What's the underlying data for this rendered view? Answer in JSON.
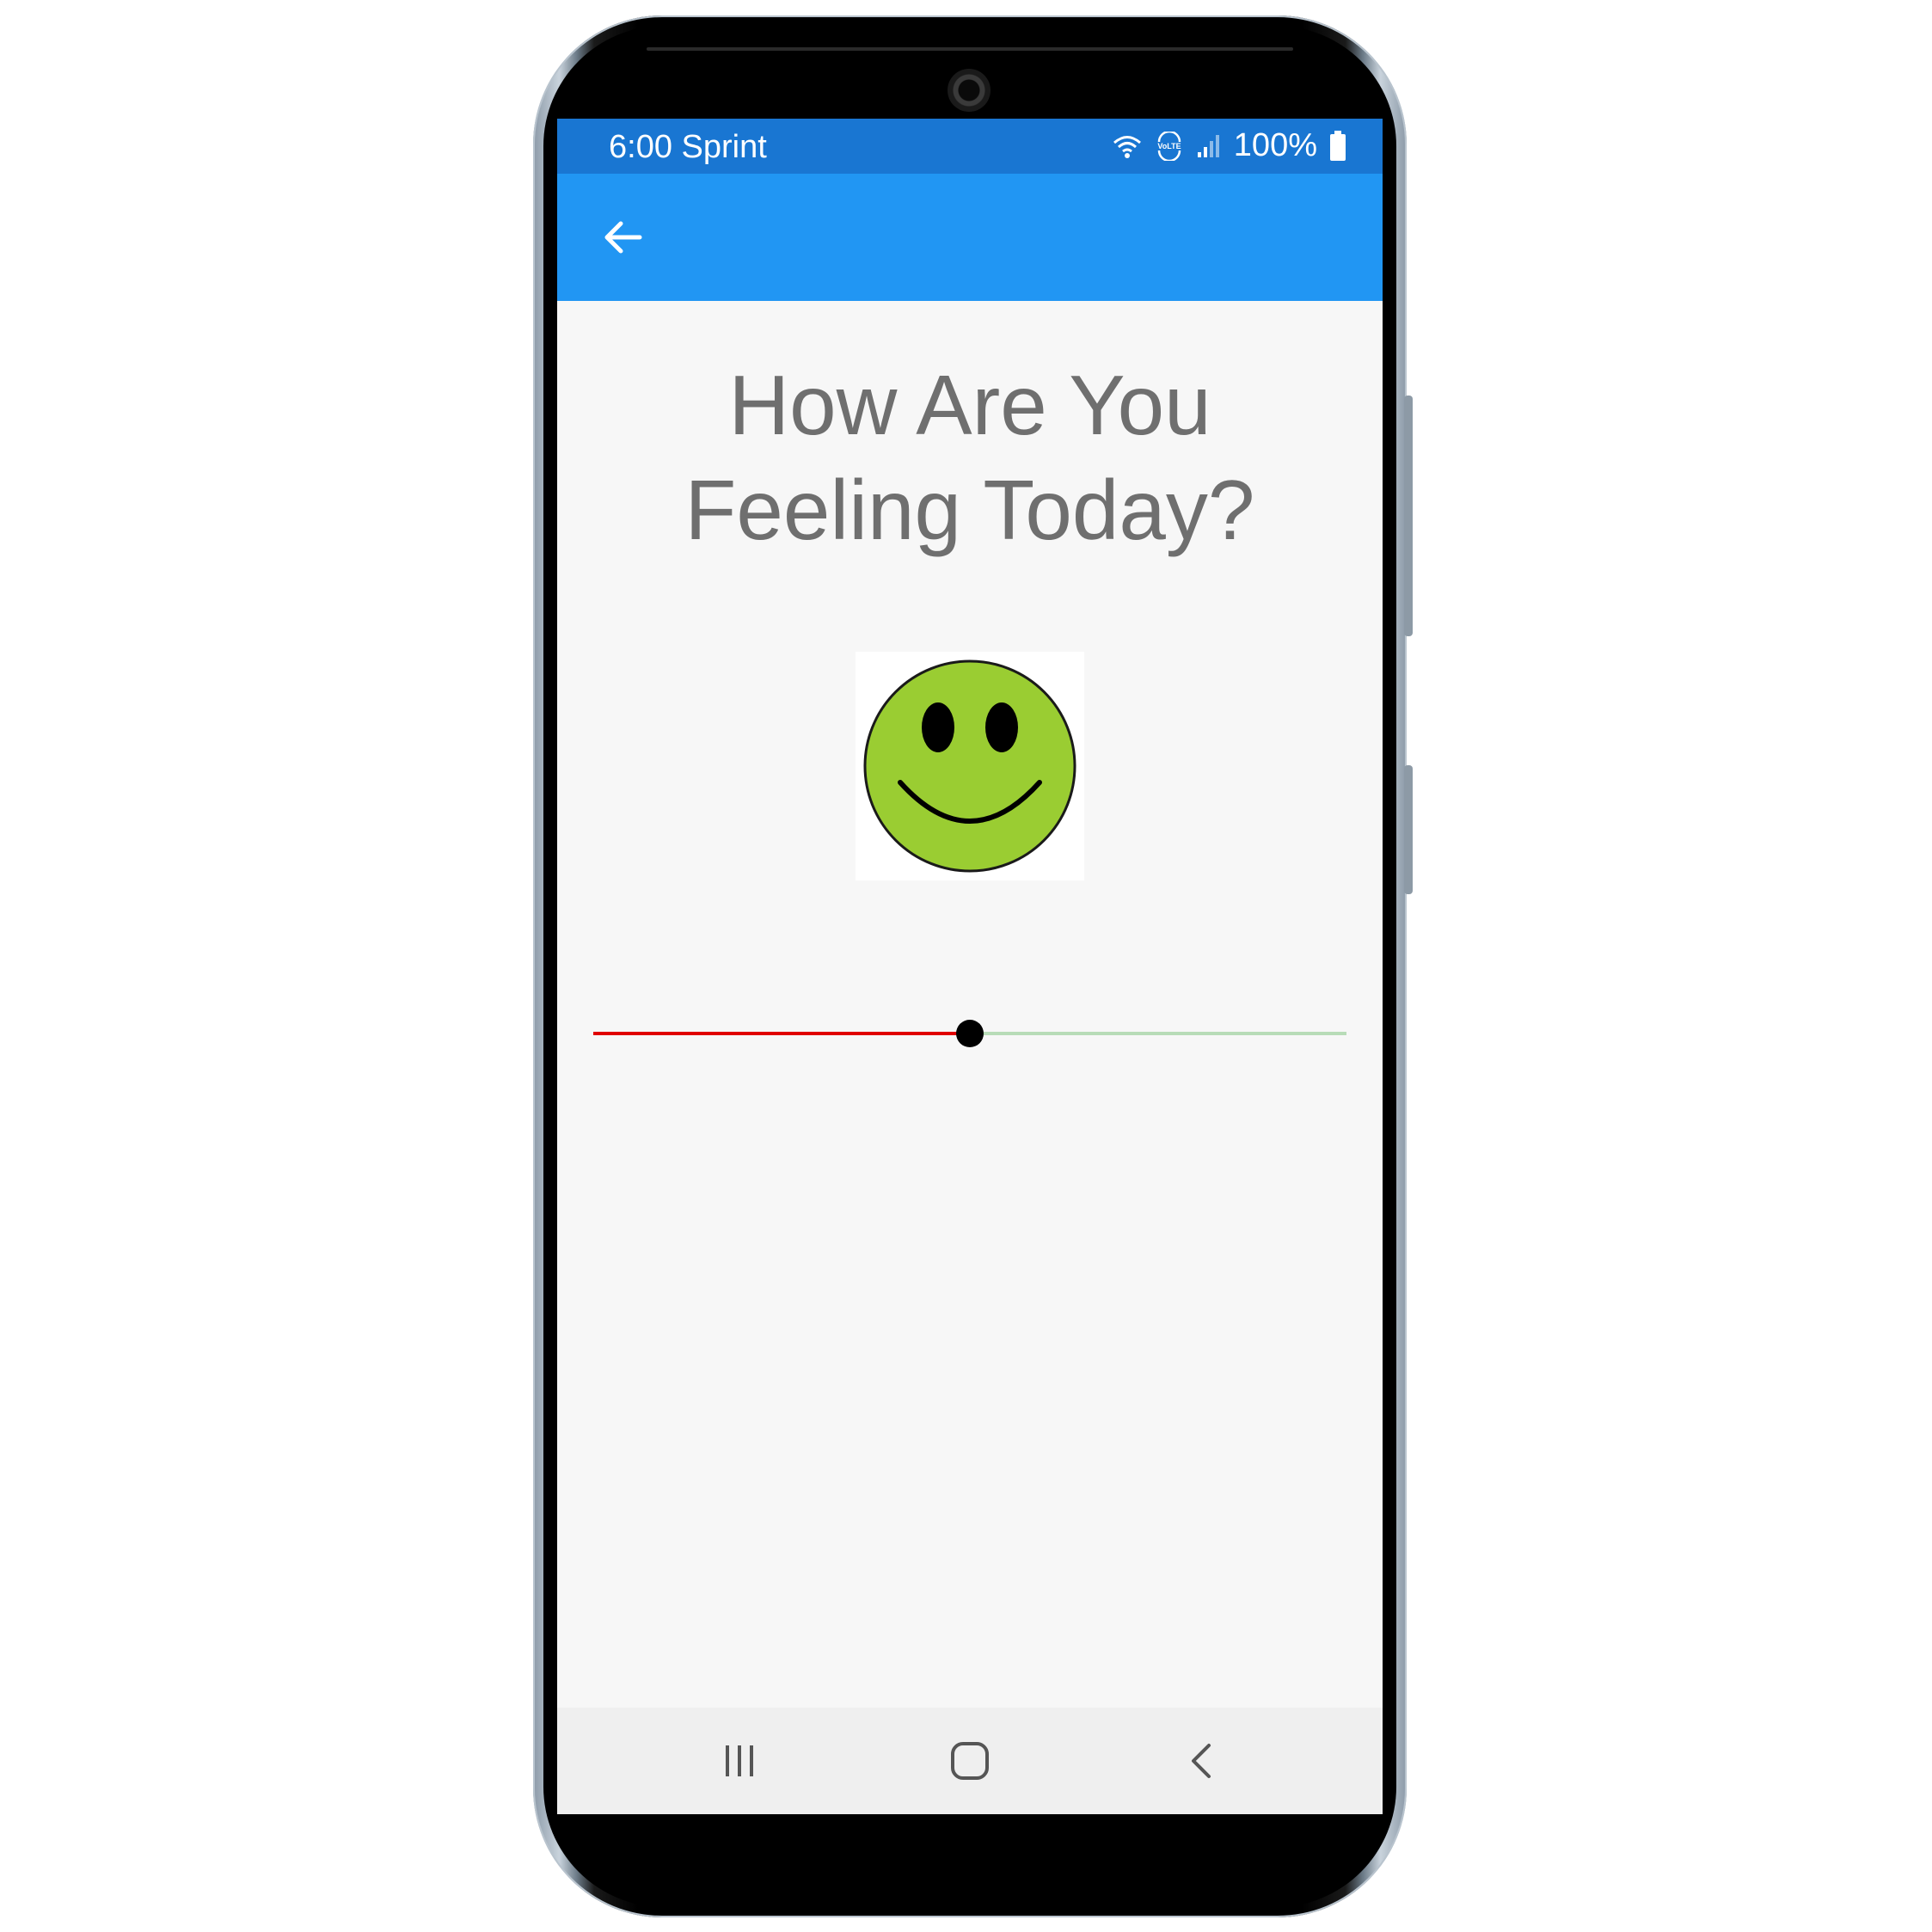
{
  "status_bar": {
    "time_carrier": "6:00 Sprint",
    "battery": "100%",
    "icons": [
      "wifi-icon",
      "volte-icon",
      "signal-icon",
      "battery-icon"
    ]
  },
  "app_bar": {
    "back_icon": "arrow-left-icon",
    "color": "#2196f3"
  },
  "content": {
    "title_line1": "How Are You",
    "title_line2": "Feeling Today?",
    "mood_icon": "smiley-face-icon",
    "mood_color": "#9acd32"
  },
  "mood_slider": {
    "value": 0.5,
    "min_track_color": "#e00000",
    "max_track_color": "#b8dcb8",
    "thumb_color": "#000000"
  },
  "nav_bar": {
    "buttons": [
      "recent-apps-icon",
      "home-icon",
      "back-icon"
    ]
  }
}
